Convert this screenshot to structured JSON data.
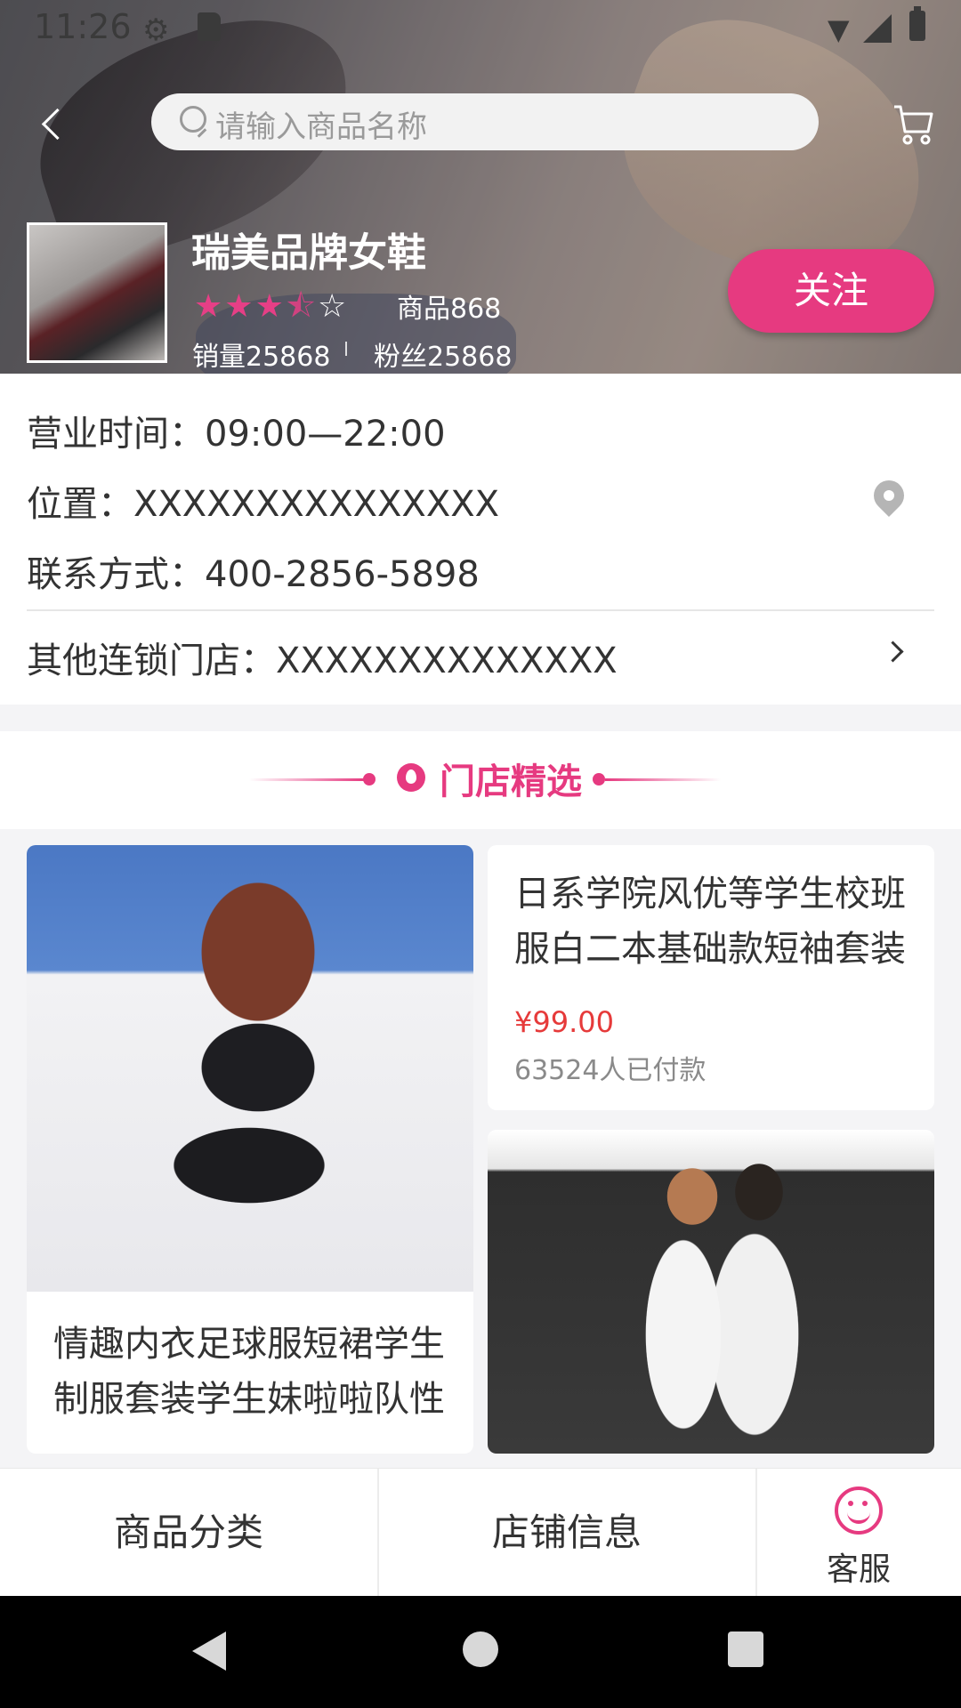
{
  "status_bar": {
    "time": "11:26"
  },
  "search": {
    "placeholder": "请输入商品名称"
  },
  "store": {
    "name": "瑞美品牌女鞋",
    "rating": 3.5,
    "rating_max": 5,
    "goods_count": "商品868",
    "sales": "销量25868",
    "fans": "粉丝25868",
    "follow_label": "关注"
  },
  "info": {
    "hours": "营业时间：09:00—22:00",
    "location": "位置：XXXXXXXXXXXXXXX",
    "contact": "联系方式：400-2856-5898",
    "chain_stores": "其他连锁门店：XXXXXXXXXXXXXX"
  },
  "section": {
    "title": "门店精选"
  },
  "products": [
    {
      "title": "情趣内衣足球服短裙学生制服套装学生妹啦啦队性"
    },
    {
      "title": "日系学院风优等学生校班服白二本基础款短袖套装",
      "price": "¥99.00",
      "sold": "63524人已付款"
    }
  ],
  "bottom_tabs": {
    "category": "商品分类",
    "store_info": "店铺信息",
    "service": "客服"
  },
  "colors": {
    "accent": "#e63a80",
    "price": "#e63a3a"
  },
  "icons": [
    "back-arrow-icon",
    "search-icon",
    "cart-icon",
    "star-icon",
    "location-pin-icon",
    "chevron-right-icon",
    "fire-icon",
    "smile-icon"
  ]
}
